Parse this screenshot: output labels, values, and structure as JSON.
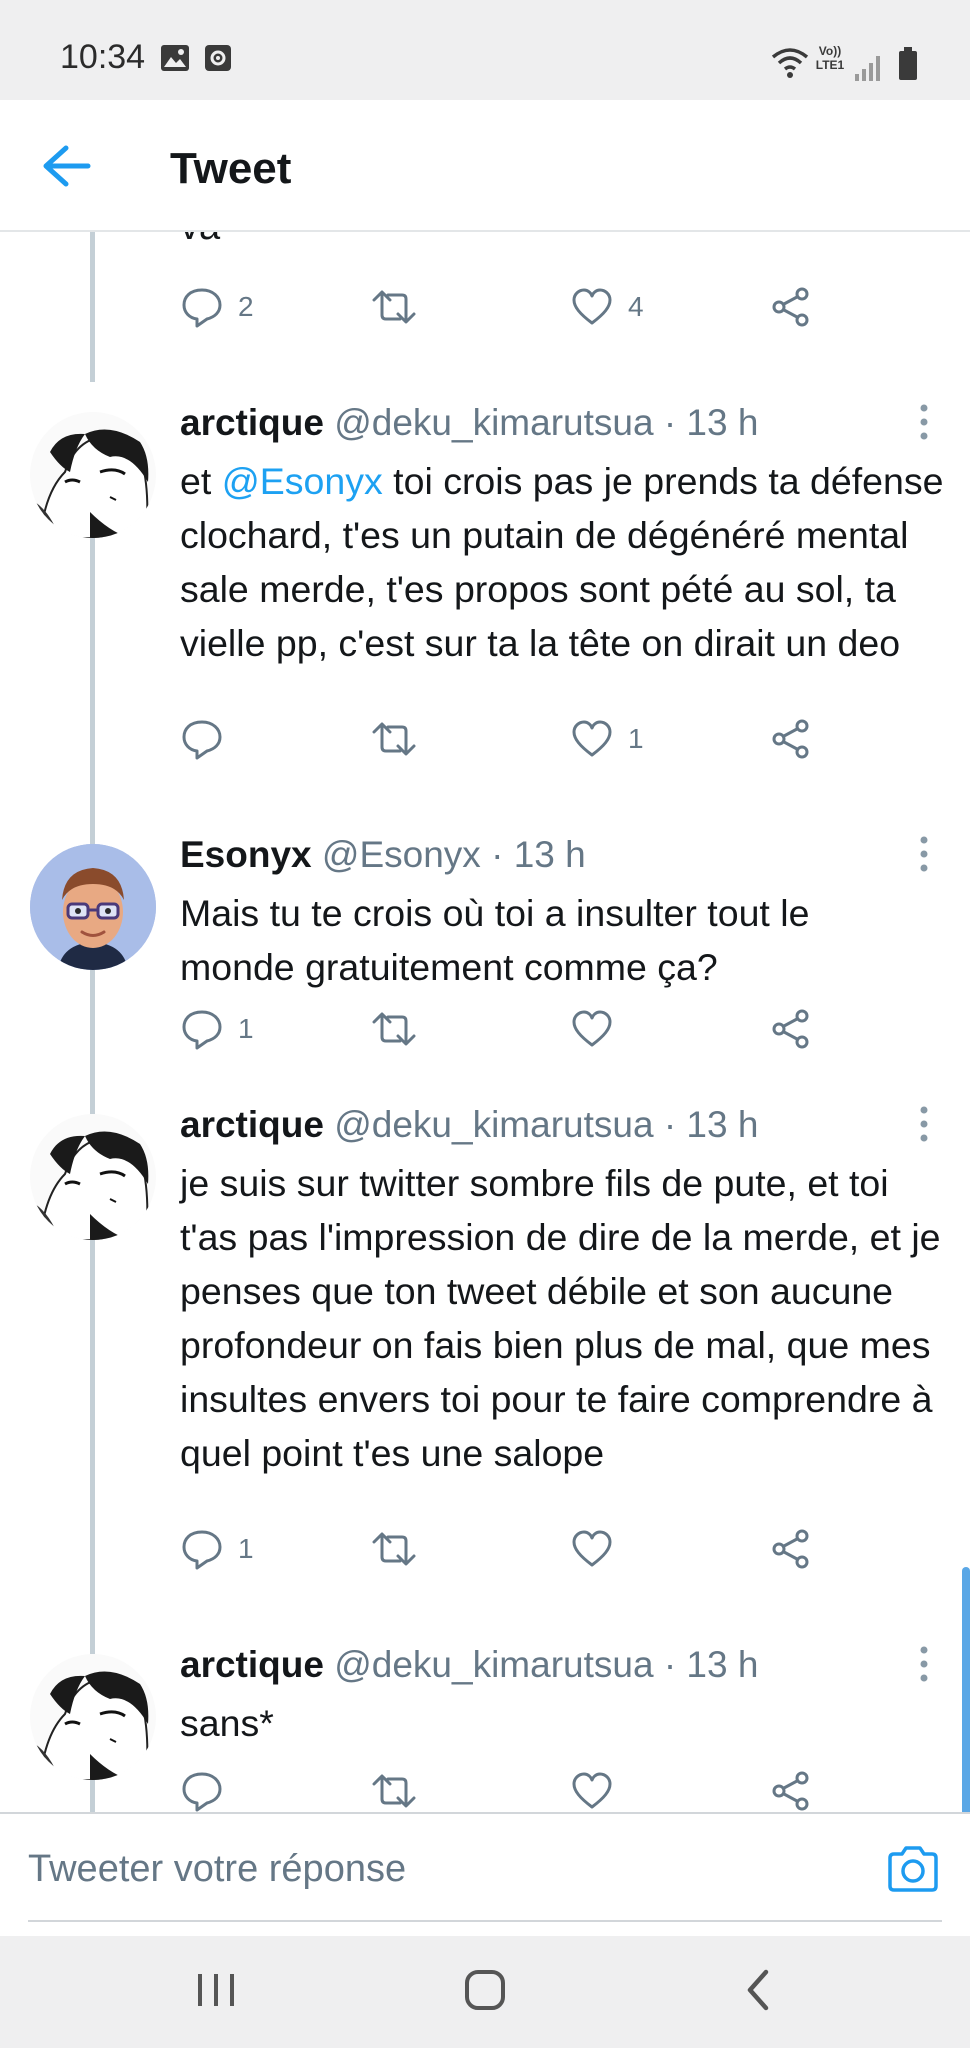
{
  "status_bar": {
    "time": "10:34",
    "icons": [
      "image-icon",
      "screen-record-icon",
      "wifi-icon",
      "volte-lte-icon",
      "signal-icon",
      "battery-icon"
    ],
    "volte_label_top": "Vo))",
    "volte_label_bottom": "LTE1"
  },
  "header": {
    "title": "Tweet",
    "back_icon": "arrow-left-icon"
  },
  "partial_tweet": {
    "text": "va",
    "replies": "2",
    "retweets": "",
    "likes": "4"
  },
  "tweets": [
    {
      "name": "arctique",
      "handle": "@deku_kimarutsua",
      "time": "· 13 h",
      "avatar": "manga-avatar",
      "text_prefix": "et ",
      "mention": "@Esonyx",
      "text_rest": " toi crois pas je prends ta défense clochard, t'es un putain de dégénéré mental sale merde, t'es propos sont pété au sol, ta vielle pp, c'est sur ta la tête on dirait un deo",
      "replies": "",
      "retweets": "",
      "likes": "1"
    },
    {
      "name": "Esonyx",
      "handle": "@Esonyx",
      "time": "· 13 h",
      "avatar": "memoji-avatar",
      "text": "Mais tu te crois où toi a insulter tout le monde gratuitement comme ça?",
      "replies": "1",
      "retweets": "",
      "likes": ""
    },
    {
      "name": "arctique",
      "handle": "@deku_kimarutsua",
      "time": "· 13 h",
      "avatar": "manga-avatar",
      "text": "je suis sur twitter sombre fils de pute, et toi t'as pas l'impression de dire de la merde, et je penses que ton tweet débile et son aucune profondeur on fais bien plus de mal, que mes insultes envers toi pour te faire comprendre à quel point t'es une salope",
      "replies": "1",
      "retweets": "",
      "likes": ""
    },
    {
      "name": "arctique",
      "handle": "@deku_kimarutsua",
      "time": "· 13 h",
      "avatar": "manga-avatar",
      "text": "sans*",
      "replies": "",
      "retweets": "",
      "likes": ""
    }
  ],
  "reply_bar": {
    "placeholder": "Tweeter votre réponse",
    "camera_icon": "camera-icon"
  },
  "nav_bar": {
    "icons": [
      "recent-apps-icon",
      "home-icon",
      "back-icon"
    ]
  },
  "colors": {
    "accent": "#1da1f2",
    "secondary_text": "#657786",
    "thread_line": "#c4cfd6",
    "system_bar": "#efeff0"
  }
}
